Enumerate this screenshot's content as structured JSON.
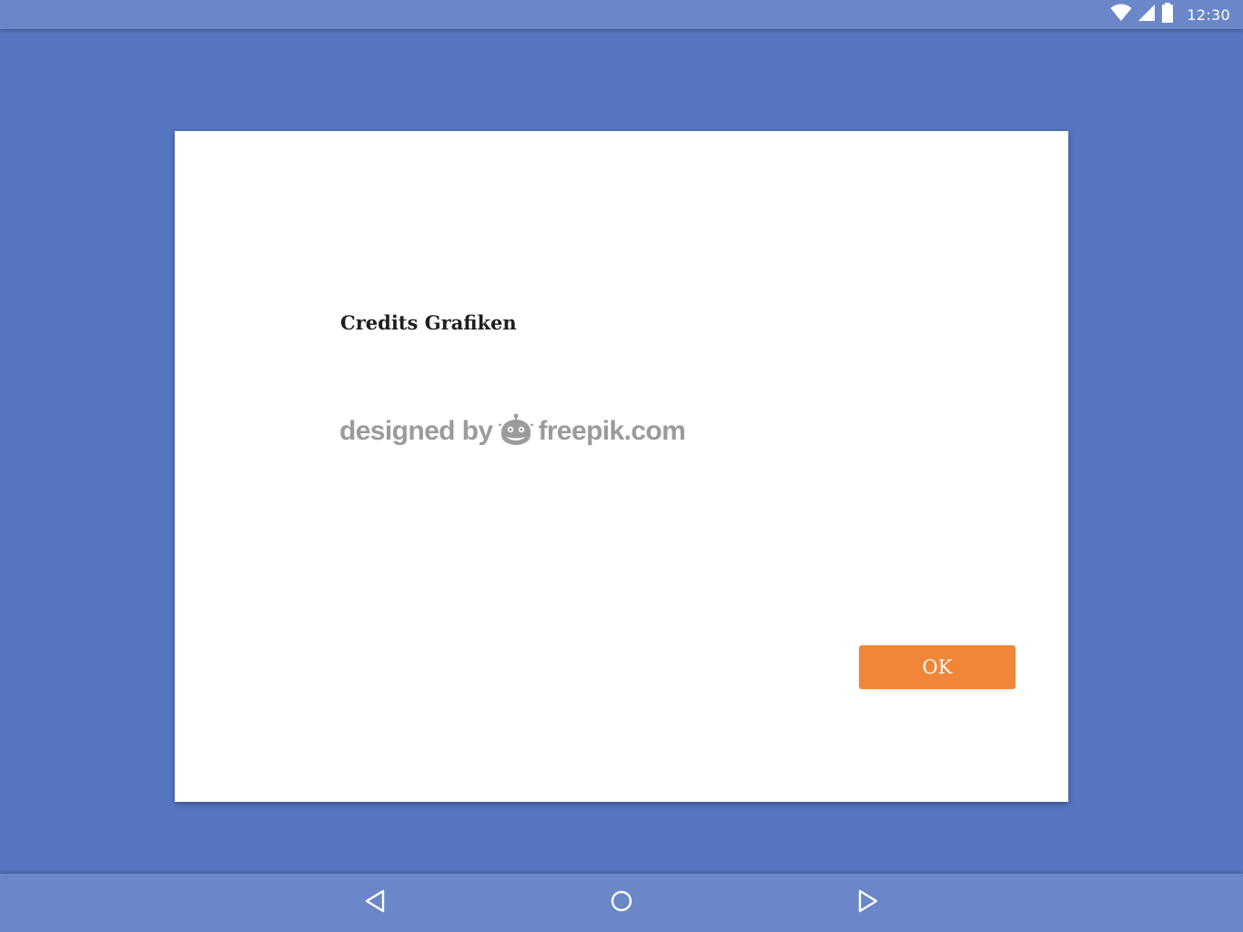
{
  "status_bar": {
    "time": "12:30",
    "icons": [
      "wifi-icon",
      "cell-signal-icon",
      "battery-icon"
    ]
  },
  "dialog": {
    "title": "Credits Grafiken",
    "credit": {
      "prefix": "designed by",
      "brand": "freepik.com",
      "icon": "freepik-mascot-icon"
    },
    "ok_label": "OK"
  },
  "nav_bar": {
    "buttons": [
      "back-icon",
      "home-icon",
      "recents-icon"
    ]
  },
  "colors": {
    "background": "#5676c1",
    "bars": "#6b87c9",
    "accent": "#f28638",
    "credit_text": "#9b9b9b"
  }
}
